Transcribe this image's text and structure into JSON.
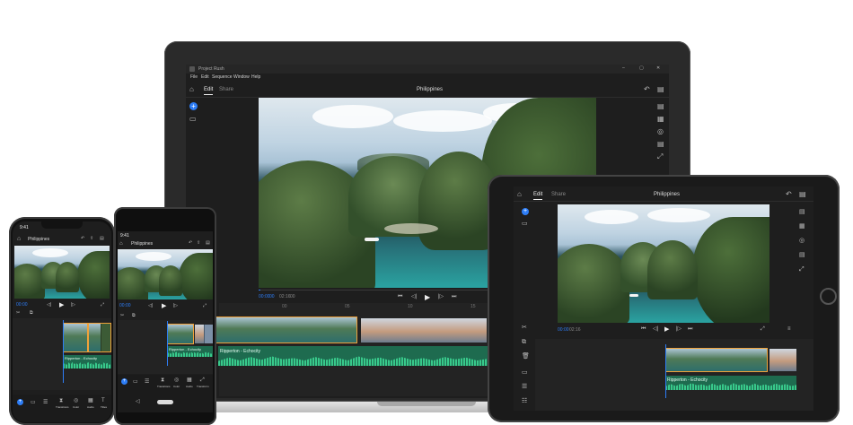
{
  "app": {
    "window_title": "Project Rush",
    "menu": [
      "File",
      "Edit",
      "Sequence",
      "Window",
      "Help"
    ],
    "tabs": [
      "Edit",
      "Share"
    ],
    "project_title": "Philippines"
  },
  "playback": {
    "current_time": "00:00",
    "frames": "00",
    "total_time": "02:16",
    "total_frames": "00",
    "progress": 0.0
  },
  "ruler_marks": [
    "00",
    "05",
    "10",
    "15",
    "20",
    "25"
  ],
  "audio_track_label": "Ripperton - Echocity",
  "phone_status": {
    "time_a": "9:41",
    "time_b": "9:41"
  },
  "mobile_toolbar": [
    "Transitions",
    "Color",
    "Audio",
    "Titles",
    "Transform"
  ],
  "colors": {
    "accent": "#2d7df6",
    "clip_outline": "#f0a23a",
    "audio_wave": "#38c98b",
    "panel": "#1e1e1e",
    "bezel": "#2a2a2a"
  },
  "icons": {
    "home": "home-icon",
    "add": "plus-circle-icon",
    "media": "media-icon",
    "undo": "undo-icon",
    "comment": "comment-icon",
    "play": "play-icon",
    "skip_back": "skip-back-icon",
    "skip_forward": "skip-forward-icon",
    "step_back": "step-back-icon",
    "step_forward": "step-forward-icon",
    "fullscreen": "fullscreen-icon"
  }
}
